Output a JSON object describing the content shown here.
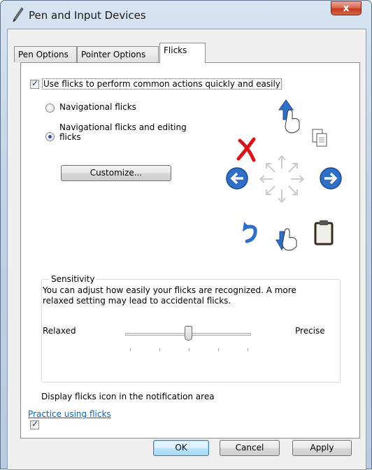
{
  "window": {
    "title": "Pen and Input Devices",
    "close_glyph": "x"
  },
  "tabs": [
    {
      "label": "Pen Options",
      "active": false
    },
    {
      "label": "Pointer Options",
      "active": false
    },
    {
      "label": "Flicks",
      "active": true
    }
  ],
  "flicks": {
    "use_flicks_label": "Use flicks to perform common actions quickly and easily",
    "use_flicks_checked": true,
    "options": [
      {
        "label": "Navigational flicks",
        "selected": false
      },
      {
        "label": "Navigational flicks and editing flicks",
        "line1": "Navigational flicks and editing",
        "line2": "flicks",
        "selected": true
      }
    ],
    "customize_label": "Customize...",
    "diagram_icons": [
      "delete-icon",
      "scroll-up-icon",
      "copy-icon",
      "back-icon",
      "forward-icon",
      "undo-icon",
      "scroll-down-icon",
      "paste-icon"
    ]
  },
  "sensitivity": {
    "title": "Sensitivity",
    "description_line1": "You can adjust how easily your flicks are recognized. A more",
    "description_line2": "relaxed setting may lead to accidental flicks.",
    "min_label": "Relaxed",
    "max_label": "Precise",
    "slider_value": 0.5,
    "tick_count": 5
  },
  "notification": {
    "label": "Display flicks icon in the notification area",
    "checked": true
  },
  "practice_link": "Practice using flicks",
  "buttons": {
    "ok": "OK",
    "cancel": "Cancel",
    "apply": "Apply"
  },
  "colors": {
    "arrow_blue": "#2f6fc6",
    "delete_red": "#d6161b",
    "link": "#0066cc"
  }
}
